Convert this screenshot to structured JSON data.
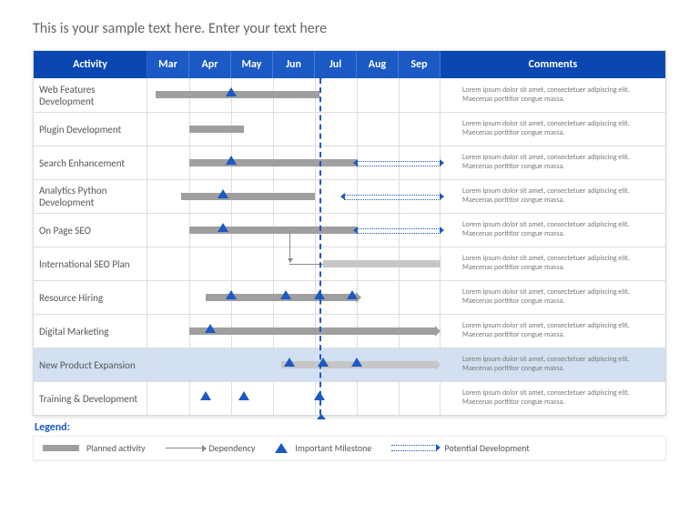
{
  "title": "This is your sample text here. Enter your text here",
  "months": [
    "Mar",
    "Apr",
    "May",
    "Jun",
    "Jul",
    "Aug",
    "Sep"
  ],
  "header": {
    "activity": "Activity",
    "comments": "Comments"
  },
  "legend": {
    "title": "Legend:",
    "planned": "Planned activity",
    "dependency": "Dependency",
    "milestone": "Important Milestone",
    "potential": "Potential Development"
  },
  "chart_data": {
    "type": "gantt",
    "x_categories": [
      "Mar",
      "Apr",
      "May",
      "Jun",
      "Jul",
      "Aug",
      "Sep"
    ],
    "today_marker": 4.1,
    "activities": [
      {
        "name": "Web Features Development",
        "bar": [
          0.2,
          4.1
        ],
        "arrow": false,
        "milestones": [
          2.0
        ],
        "comment": "Lorem ipsum dolor sit amet, consectetuer adipiscing elit. Maecenas porttitor congue massa."
      },
      {
        "name": "Plugin Development",
        "bar": [
          1.0,
          2.3
        ],
        "arrow": false,
        "milestones": [],
        "comment": "Lorem ipsum dolor sit amet, consectetuer adipiscing elit. Maecenas porttitor congue massa."
      },
      {
        "name": "Search Enhancement",
        "bar": [
          1.0,
          5.0
        ],
        "arrow": false,
        "milestones": [
          2.0
        ],
        "potential": [
          5.0,
          7.0
        ],
        "comment": "Lorem ipsum dolor sit amet, consectetuer adipiscing elit. Maecenas porttitor congue massa."
      },
      {
        "name": "Analytics Python Development",
        "bar": [
          0.8,
          4.0
        ],
        "arrow": false,
        "milestones": [
          1.8
        ],
        "potential": [
          4.7,
          7.0
        ],
        "comment": "Lorem ipsum dolor sit amet, consectetuer adipiscing elit. Maecenas porttitor congue massa."
      },
      {
        "name": "On Page SEO",
        "bar": [
          1.0,
          5.0
        ],
        "arrow": false,
        "milestones": [
          1.8
        ],
        "potential": [
          5.0,
          7.0
        ],
        "comment": "Lorem ipsum dolor sit amet, consectetuer adipiscing elit. Maecenas porttitor congue massa."
      },
      {
        "name": "International SEO Plan",
        "bar": [
          4.2,
          7.0
        ],
        "arrow": false,
        "light": true,
        "milestones": [],
        "dependency_from_above": 3.4,
        "comment": "Lorem ipsum dolor sit amet, consectetuer adipiscing elit. Maecenas porttitor congue massa."
      },
      {
        "name": "Resource Hiring",
        "bar": [
          1.4,
          5.1
        ],
        "arrow": true,
        "milestones": [
          2.0,
          3.3,
          4.1,
          4.9
        ],
        "comment": "Lorem ipsum dolor sit amet, consectetuer adipiscing elit. Maecenas porttitor congue massa."
      },
      {
        "name": "Digital Marketing",
        "bar": [
          1.0,
          7.0
        ],
        "arrow": true,
        "milestones": [
          1.5
        ],
        "comment": "Lorem ipsum dolor sit amet, consectetuer adipiscing elit. Maecenas porttitor congue massa."
      },
      {
        "name": "New Product Expansion",
        "bar": [
          3.2,
          7.0
        ],
        "arrow": true,
        "light": true,
        "milestones": [
          3.4,
          4.2,
          5.0
        ],
        "highlight": true,
        "comment": "Lorem ipsum dolor sit amet, consectetuer adipiscing elit. Maecenas porttitor congue massa."
      },
      {
        "name": "Training & Development",
        "bar": null,
        "milestones": [
          1.4,
          2.3,
          4.1
        ],
        "comment": "Lorem ipsum dolor sit amet, consectetuer adipiscing elit. Maecenas porttitor congue massa."
      }
    ]
  }
}
